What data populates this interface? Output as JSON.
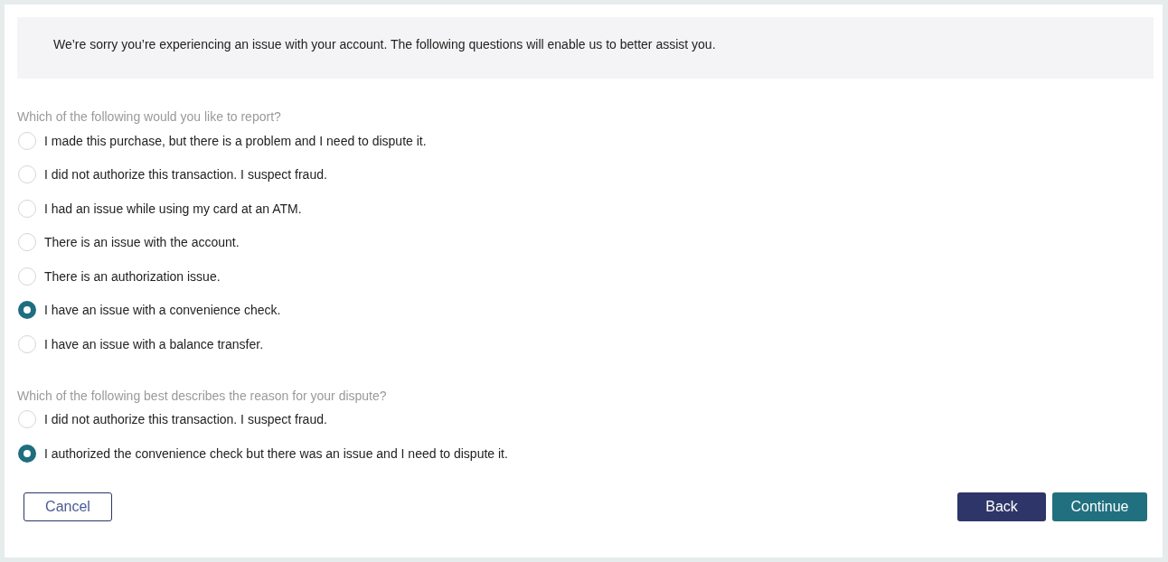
{
  "banner": {
    "text": "We’re sorry you’re experiencing an issue with your account. The following questions will enable us to better assist you."
  },
  "questions": [
    {
      "label": "Which of the following would you like to report?",
      "options": [
        {
          "label": "I made this purchase, but there is a problem and I need to dispute it.",
          "selected": false
        },
        {
          "label": "I did not authorize this transaction. I suspect fraud.",
          "selected": false
        },
        {
          "label": "I had an issue while using my card at an ATM.",
          "selected": false
        },
        {
          "label": "There is an issue with the account.",
          "selected": false
        },
        {
          "label": "There is an authorization issue.",
          "selected": false
        },
        {
          "label": "I have an issue with a convenience check.",
          "selected": true
        },
        {
          "label": "I have an issue with a balance transfer.",
          "selected": false
        }
      ]
    },
    {
      "label": "Which of the following best describes the reason for your dispute?",
      "options": [
        {
          "label": "I did not authorize this transaction. I suspect fraud.",
          "selected": false
        },
        {
          "label": "I authorized the convenience check but there was an issue and I need to dispute it.",
          "selected": true
        }
      ]
    }
  ],
  "buttons": {
    "cancel": "Cancel",
    "back": "Back",
    "continue": "Continue"
  }
}
